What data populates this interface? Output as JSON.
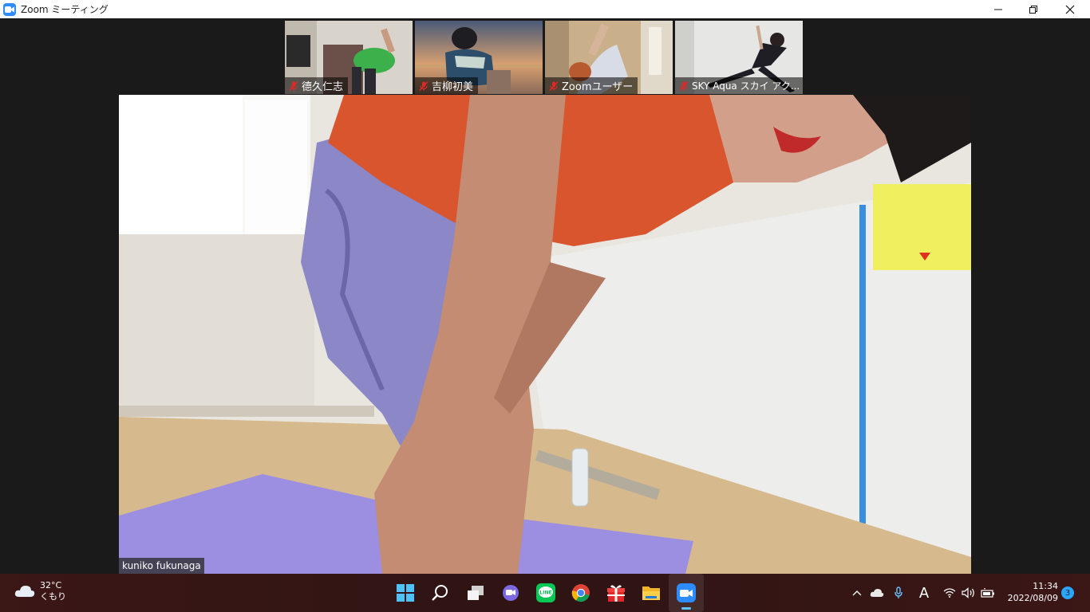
{
  "window": {
    "title": "Zoom ミーティング",
    "controls": {
      "minimize": "—",
      "maximize": "❐",
      "close": "✕"
    }
  },
  "participants": [
    {
      "name": "德久仁志",
      "muted": true
    },
    {
      "name": "吉柳初美",
      "muted": true
    },
    {
      "name": "Zoomユーザー",
      "muted": true
    },
    {
      "name": "SKY Aqua  スカイ アク...",
      "muted": true
    }
  ],
  "active_speaker": {
    "name": "kuniko fukunaga"
  },
  "taskbar": {
    "weather": {
      "temperature": "32°C",
      "condition": "くもり",
      "icon": "cloud-icon"
    },
    "apps": [
      {
        "name": "start",
        "icon": "windows-start-icon"
      },
      {
        "name": "search",
        "icon": "search-icon"
      },
      {
        "name": "task-view",
        "icon": "task-view-icon"
      },
      {
        "name": "chat",
        "icon": "teams-chat-icon"
      },
      {
        "name": "line",
        "icon": "line-icon",
        "label": "LINE"
      },
      {
        "name": "chrome",
        "icon": "chrome-icon"
      },
      {
        "name": "gift",
        "icon": "gift-icon"
      },
      {
        "name": "file-explorer",
        "icon": "folder-icon"
      },
      {
        "name": "zoom",
        "icon": "zoom-icon",
        "active": true
      }
    ],
    "tray": {
      "chevron": "^",
      "ime_label": "A",
      "time": "11:34",
      "date": "2022/08/09",
      "notification_count": "3"
    }
  },
  "colors": {
    "zoom_blue": "#2d8cff",
    "mute_red": "#e02828",
    "taskbar_bg": "#3b1716",
    "meeting_bg": "#1a1a1a"
  }
}
